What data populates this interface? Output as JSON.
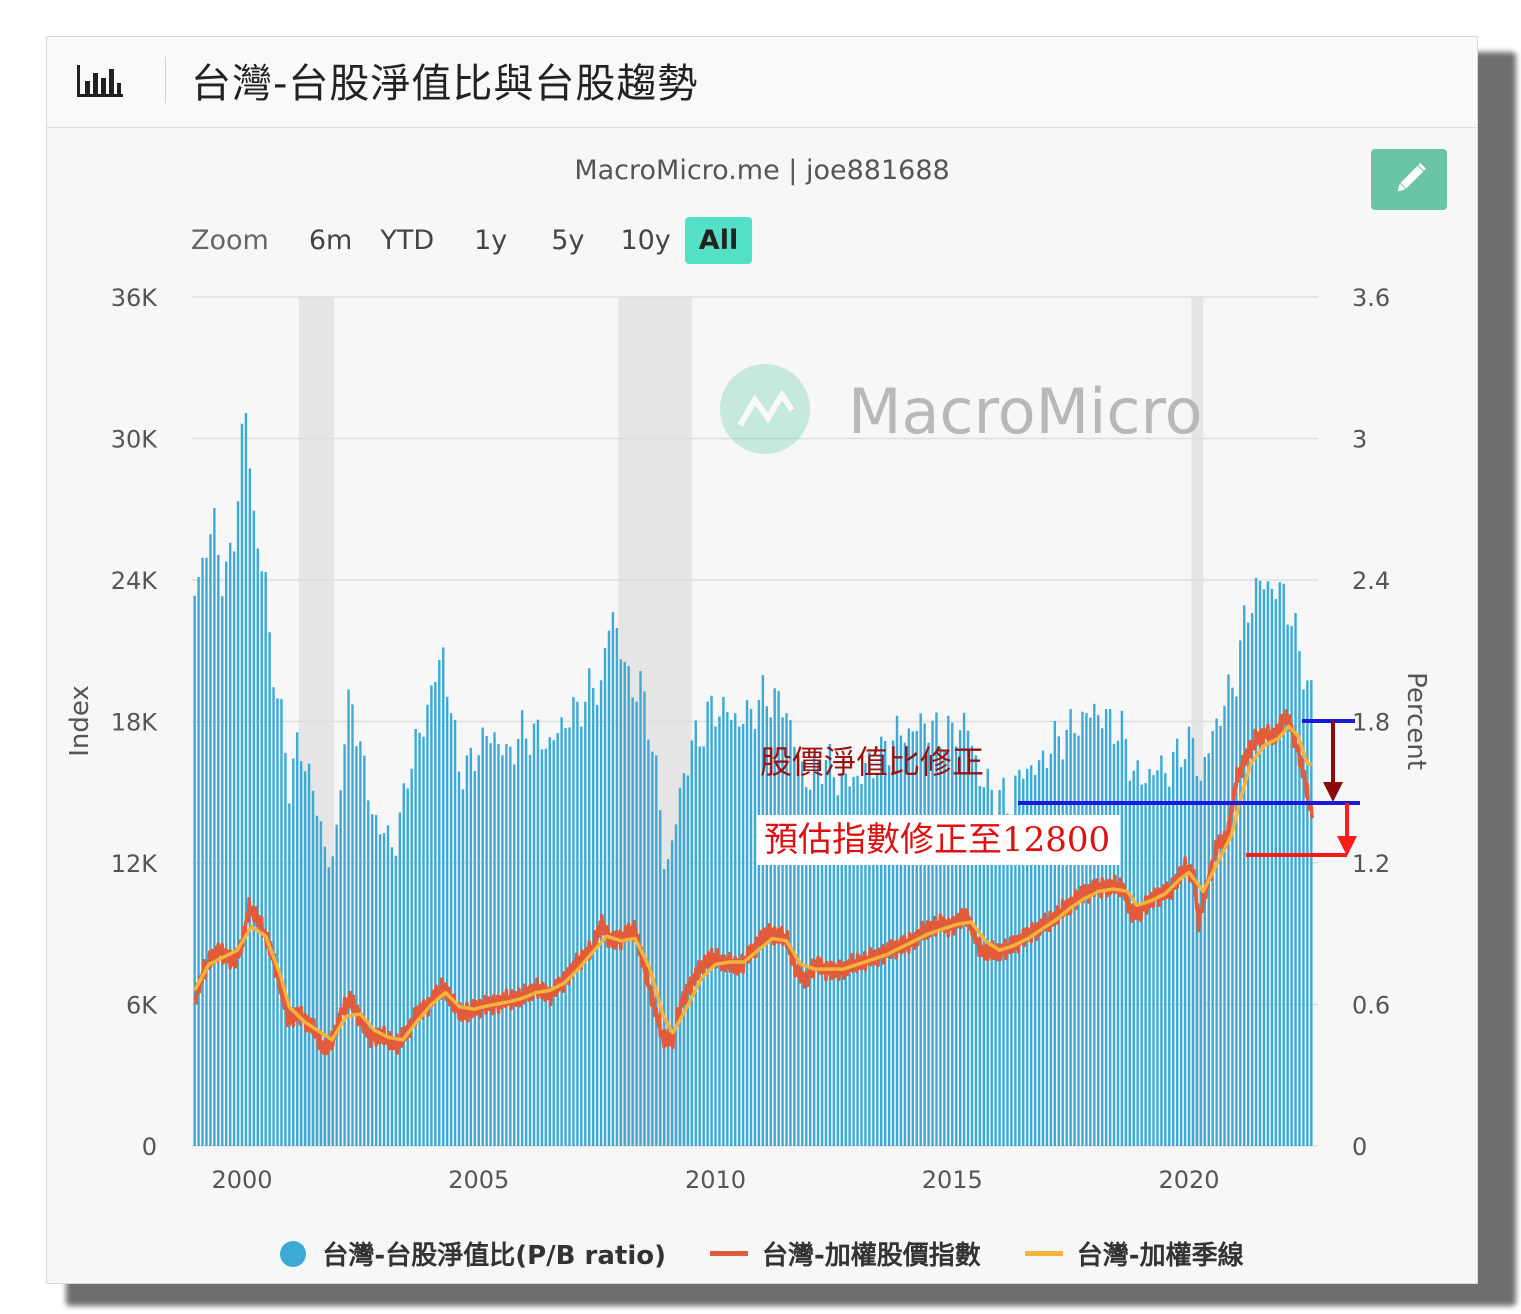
{
  "header": {
    "title": "台灣-台股淨值比與台股趨勢"
  },
  "subtitle": "MacroMicro.me | joe881688",
  "zoom": {
    "label": "Zoom",
    "options": [
      "6m",
      "YTD",
      "1y",
      "5y",
      "10y",
      "All"
    ],
    "active": "All"
  },
  "watermark": "MacroMicro",
  "colors": {
    "bars": "#3baad6",
    "price": "#e25b3a",
    "seasonal": "#f5b33c",
    "recession": "#e2e2e2",
    "accent": "#6cc4a8"
  },
  "legend": [
    {
      "name": "台灣-台股淨值比(P/B ratio)",
      "marker": "dot",
      "color": "#3baad6"
    },
    {
      "name": "台灣-加權股價指數",
      "marker": "line",
      "color": "#e25b3a"
    },
    {
      "name": "台灣-加權季線",
      "marker": "line",
      "color": "#f5b33c"
    }
  ],
  "annotations": {
    "pb_correction": "股價淨值比修正",
    "index_forecast": "預估指數修正至12800"
  },
  "chart_data": {
    "type": "bar",
    "title": "台灣-台股淨值比與台股趨勢",
    "y_left": {
      "label": "Index",
      "ticks": [
        "0",
        "6K",
        "12K",
        "18K",
        "24K",
        "30K",
        "36K"
      ],
      "range": [
        0,
        36000
      ]
    },
    "y_right": {
      "label": "Percent",
      "ticks": [
        "0",
        "0.6",
        "1.2",
        "1.8",
        "2.4",
        "3",
        "3.6"
      ],
      "range": [
        0,
        3.6
      ]
    },
    "x_ticks": [
      "2000",
      "2005",
      "2010",
      "2015",
      "2020"
    ],
    "x_range": [
      1999.0,
      2022.6
    ],
    "recession_bands": [
      [
        2001.2,
        2001.95
      ],
      [
        2007.95,
        2009.5
      ],
      [
        2020.05,
        2020.3
      ]
    ],
    "grid": true,
    "legend_position": "bottom",
    "series": [
      {
        "name": "台灣-台股淨值比(P/B ratio)",
        "type": "bar",
        "axis": "right",
        "points": [
          [
            1999.0,
            2.35
          ],
          [
            1999.2,
            2.5
          ],
          [
            1999.4,
            2.65
          ],
          [
            1999.6,
            2.4
          ],
          [
            1999.8,
            2.5
          ],
          [
            2000.0,
            3.0
          ],
          [
            2000.1,
            3.1
          ],
          [
            2000.3,
            2.55
          ],
          [
            2000.5,
            2.4
          ],
          [
            2000.6,
            2.1
          ],
          [
            2000.8,
            1.85
          ],
          [
            2001.0,
            1.55
          ],
          [
            2001.2,
            1.7
          ],
          [
            2001.4,
            1.6
          ],
          [
            2001.6,
            1.4
          ],
          [
            2001.8,
            1.25
          ],
          [
            2001.95,
            1.15
          ],
          [
            2002.1,
            1.65
          ],
          [
            2002.3,
            1.9
          ],
          [
            2002.5,
            1.7
          ],
          [
            2002.7,
            1.45
          ],
          [
            2002.9,
            1.35
          ],
          [
            2003.1,
            1.3
          ],
          [
            2003.3,
            1.3
          ],
          [
            2003.5,
            1.6
          ],
          [
            2003.7,
            1.7
          ],
          [
            2003.9,
            1.85
          ],
          [
            2004.1,
            2.0
          ],
          [
            2004.25,
            2.1
          ],
          [
            2004.4,
            1.85
          ],
          [
            2004.6,
            1.6
          ],
          [
            2004.8,
            1.6
          ],
          [
            2005.0,
            1.7
          ],
          [
            2005.3,
            1.75
          ],
          [
            2005.6,
            1.65
          ],
          [
            2005.9,
            1.75
          ],
          [
            2006.2,
            1.75
          ],
          [
            2006.5,
            1.7
          ],
          [
            2006.8,
            1.8
          ],
          [
            2007.1,
            1.85
          ],
          [
            2007.4,
            1.95
          ],
          [
            2007.6,
            1.95
          ],
          [
            2007.8,
            2.3
          ],
          [
            2008.0,
            2.1
          ],
          [
            2008.2,
            1.95
          ],
          [
            2008.4,
            1.95
          ],
          [
            2008.6,
            1.8
          ],
          [
            2008.8,
            1.5
          ],
          [
            2008.95,
            1.15
          ],
          [
            2009.1,
            1.3
          ],
          [
            2009.3,
            1.55
          ],
          [
            2009.5,
            1.7
          ],
          [
            2009.7,
            1.75
          ],
          [
            2009.9,
            1.85
          ],
          [
            2010.2,
            1.85
          ],
          [
            2010.5,
            1.8
          ],
          [
            2010.8,
            1.85
          ],
          [
            2011.0,
            1.9
          ],
          [
            2011.2,
            1.9
          ],
          [
            2011.5,
            1.85
          ],
          [
            2011.8,
            1.6
          ],
          [
            2012.0,
            1.55
          ],
          [
            2012.3,
            1.65
          ],
          [
            2012.6,
            1.55
          ],
          [
            2012.9,
            1.55
          ],
          [
            2013.2,
            1.6
          ],
          [
            2013.5,
            1.65
          ],
          [
            2013.8,
            1.75
          ],
          [
            2014.1,
            1.75
          ],
          [
            2014.4,
            1.8
          ],
          [
            2014.7,
            1.75
          ],
          [
            2015.0,
            1.75
          ],
          [
            2015.3,
            1.8
          ],
          [
            2015.6,
            1.55
          ],
          [
            2015.9,
            1.5
          ],
          [
            2016.2,
            1.45
          ],
          [
            2016.5,
            1.6
          ],
          [
            2016.8,
            1.6
          ],
          [
            2017.1,
            1.7
          ],
          [
            2017.4,
            1.75
          ],
          [
            2017.7,
            1.8
          ],
          [
            2018.0,
            1.85
          ],
          [
            2018.3,
            1.8
          ],
          [
            2018.6,
            1.75
          ],
          [
            2018.8,
            1.6
          ],
          [
            2019.0,
            1.55
          ],
          [
            2019.3,
            1.6
          ],
          [
            2019.6,
            1.6
          ],
          [
            2019.9,
            1.7
          ],
          [
            2020.1,
            1.7
          ],
          [
            2020.25,
            1.55
          ],
          [
            2020.5,
            1.75
          ],
          [
            2020.8,
            1.9
          ],
          [
            2021.0,
            2.0
          ],
          [
            2021.2,
            2.25
          ],
          [
            2021.4,
            2.35
          ],
          [
            2021.6,
            2.4
          ],
          [
            2021.8,
            2.35
          ],
          [
            2022.0,
            2.35
          ],
          [
            2022.2,
            2.2
          ],
          [
            2022.4,
            2.05
          ],
          [
            2022.55,
            1.9
          ]
        ]
      },
      {
        "name": "台灣-加權股價指數",
        "type": "line",
        "axis": "left",
        "points": [
          [
            1999.0,
            6200
          ],
          [
            1999.2,
            7500
          ],
          [
            1999.5,
            8300
          ],
          [
            1999.8,
            7800
          ],
          [
            2000.0,
            8500
          ],
          [
            2000.15,
            10100
          ],
          [
            2000.3,
            9800
          ],
          [
            2000.6,
            8400
          ],
          [
            2000.8,
            6800
          ],
          [
            2001.0,
            5300
          ],
          [
            2001.2,
            5600
          ],
          [
            2001.5,
            5000
          ],
          [
            2001.7,
            4200
          ],
          [
            2001.9,
            4400
          ],
          [
            2002.1,
            5700
          ],
          [
            2002.3,
            6200
          ],
          [
            2002.5,
            5400
          ],
          [
            2002.7,
            4600
          ],
          [
            2002.9,
            4700
          ],
          [
            2003.1,
            4500
          ],
          [
            2003.3,
            4300
          ],
          [
            2003.5,
            4900
          ],
          [
            2003.7,
            5600
          ],
          [
            2003.9,
            5900
          ],
          [
            2004.1,
            6400
          ],
          [
            2004.25,
            6800
          ],
          [
            2004.5,
            5900
          ],
          [
            2004.7,
            5600
          ],
          [
            2005.0,
            5900
          ],
          [
            2005.3,
            6000
          ],
          [
            2005.6,
            6200
          ],
          [
            2005.9,
            6300
          ],
          [
            2006.2,
            6700
          ],
          [
            2006.5,
            6400
          ],
          [
            2006.8,
            7000
          ],
          [
            2007.1,
            7800
          ],
          [
            2007.4,
            8400
          ],
          [
            2007.6,
            9500
          ],
          [
            2007.75,
            8700
          ],
          [
            2008.0,
            8800
          ],
          [
            2008.3,
            9200
          ],
          [
            2008.5,
            7500
          ],
          [
            2008.7,
            6000
          ],
          [
            2008.9,
            4500
          ],
          [
            2009.1,
            4600
          ],
          [
            2009.3,
            6200
          ],
          [
            2009.5,
            6900
          ],
          [
            2009.7,
            7600
          ],
          [
            2009.9,
            8000
          ],
          [
            2010.2,
            7800
          ],
          [
            2010.5,
            7600
          ],
          [
            2010.8,
            8300
          ],
          [
            2011.0,
            8900
          ],
          [
            2011.2,
            9000
          ],
          [
            2011.5,
            8800
          ],
          [
            2011.7,
            7500
          ],
          [
            2011.9,
            7000
          ],
          [
            2012.1,
            7700
          ],
          [
            2012.3,
            7500
          ],
          [
            2012.6,
            7400
          ],
          [
            2012.9,
            7700
          ],
          [
            2013.2,
            7900
          ],
          [
            2013.5,
            8100
          ],
          [
            2013.8,
            8400
          ],
          [
            2014.1,
            8600
          ],
          [
            2014.4,
            9100
          ],
          [
            2014.7,
            9400
          ],
          [
            2015.0,
            9300
          ],
          [
            2015.3,
            9800
          ],
          [
            2015.6,
            8300
          ],
          [
            2015.9,
            8200
          ],
          [
            2016.2,
            8400
          ],
          [
            2016.5,
            8800
          ],
          [
            2016.8,
            9200
          ],
          [
            2017.1,
            9600
          ],
          [
            2017.4,
            10100
          ],
          [
            2017.7,
            10600
          ],
          [
            2018.0,
            10900
          ],
          [
            2018.3,
            11000
          ],
          [
            2018.6,
            11000
          ],
          [
            2018.8,
            9800
          ],
          [
            2019.0,
            10000
          ],
          [
            2019.3,
            10600
          ],
          [
            2019.6,
            10800
          ],
          [
            2019.9,
            11800
          ],
          [
            2020.1,
            11500
          ],
          [
            2020.2,
            9500
          ],
          [
            2020.35,
            10800
          ],
          [
            2020.6,
            12800
          ],
          [
            2020.8,
            13000
          ],
          [
            2021.0,
            15500
          ],
          [
            2021.2,
            16500
          ],
          [
            2021.4,
            17200
          ],
          [
            2021.6,
            17500
          ],
          [
            2021.8,
            17300
          ],
          [
            2022.0,
            18200
          ],
          [
            2022.15,
            17800
          ],
          [
            2022.3,
            16800
          ],
          [
            2022.45,
            15500
          ],
          [
            2022.55,
            14300
          ]
        ]
      },
      {
        "name": "台灣-加權季線",
        "type": "line",
        "axis": "left",
        "points": [
          [
            1999.0,
            6600
          ],
          [
            1999.3,
            7700
          ],
          [
            1999.6,
            8000
          ],
          [
            1999.9,
            8300
          ],
          [
            2000.2,
            9300
          ],
          [
            2000.5,
            8900
          ],
          [
            2000.8,
            7300
          ],
          [
            2001.0,
            5900
          ],
          [
            2001.3,
            5300
          ],
          [
            2001.6,
            4900
          ],
          [
            2001.9,
            4500
          ],
          [
            2002.2,
            5500
          ],
          [
            2002.5,
            5600
          ],
          [
            2002.8,
            4900
          ],
          [
            2003.1,
            4600
          ],
          [
            2003.4,
            4500
          ],
          [
            2003.7,
            5300
          ],
          [
            2004.0,
            6000
          ],
          [
            2004.3,
            6500
          ],
          [
            2004.6,
            5900
          ],
          [
            2004.9,
            5800
          ],
          [
            2005.2,
            5950
          ],
          [
            2005.6,
            6100
          ],
          [
            2005.9,
            6250
          ],
          [
            2006.2,
            6500
          ],
          [
            2006.5,
            6600
          ],
          [
            2006.8,
            6900
          ],
          [
            2007.1,
            7500
          ],
          [
            2007.4,
            8200
          ],
          [
            2007.7,
            8900
          ],
          [
            2008.0,
            8700
          ],
          [
            2008.3,
            8800
          ],
          [
            2008.6,
            7600
          ],
          [
            2008.9,
            5500
          ],
          [
            2009.1,
            4800
          ],
          [
            2009.4,
            5900
          ],
          [
            2009.7,
            7100
          ],
          [
            2010.0,
            7700
          ],
          [
            2010.3,
            7800
          ],
          [
            2010.6,
            7800
          ],
          [
            2010.9,
            8300
          ],
          [
            2011.2,
            8800
          ],
          [
            2011.5,
            8700
          ],
          [
            2011.8,
            7700
          ],
          [
            2012.1,
            7500
          ],
          [
            2012.4,
            7500
          ],
          [
            2012.7,
            7500
          ],
          [
            2013.0,
            7700
          ],
          [
            2013.3,
            7900
          ],
          [
            2013.6,
            8100
          ],
          [
            2013.9,
            8400
          ],
          [
            2014.2,
            8700
          ],
          [
            2014.5,
            9000
          ],
          [
            2014.8,
            9200
          ],
          [
            2015.1,
            9400
          ],
          [
            2015.4,
            9500
          ],
          [
            2015.7,
            8700
          ],
          [
            2016.0,
            8300
          ],
          [
            2016.3,
            8500
          ],
          [
            2016.6,
            8800
          ],
          [
            2016.9,
            9200
          ],
          [
            2017.2,
            9600
          ],
          [
            2017.5,
            10100
          ],
          [
            2017.8,
            10500
          ],
          [
            2018.1,
            10800
          ],
          [
            2018.4,
            10900
          ],
          [
            2018.7,
            10800
          ],
          [
            2018.9,
            10200
          ],
          [
            2019.2,
            10400
          ],
          [
            2019.5,
            10700
          ],
          [
            2019.8,
            11300
          ],
          [
            2020.0,
            11600
          ],
          [
            2020.3,
            10800
          ],
          [
            2020.6,
            12000
          ],
          [
            2020.9,
            13200
          ],
          [
            2021.1,
            14800
          ],
          [
            2021.3,
            16200
          ],
          [
            2021.6,
            17000
          ],
          [
            2021.9,
            17300
          ],
          [
            2022.1,
            17800
          ],
          [
            2022.3,
            17400
          ],
          [
            2022.5,
            16200
          ]
        ]
      }
    ]
  }
}
